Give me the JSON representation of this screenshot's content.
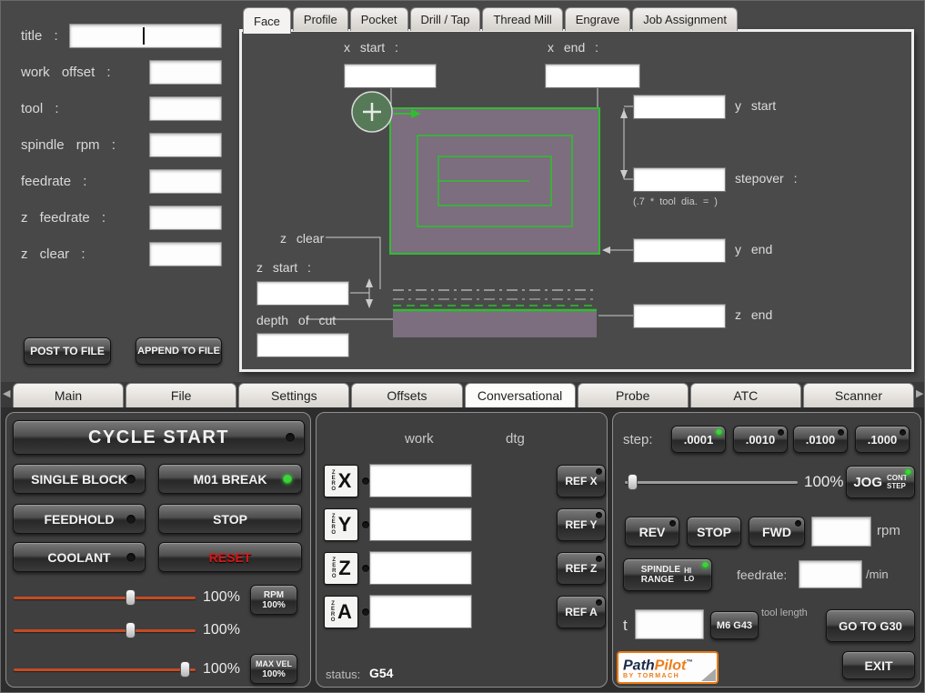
{
  "left_form": {
    "fields": [
      {
        "label": "title :",
        "value": ""
      },
      {
        "label": "work offset :",
        "value": ""
      },
      {
        "label": "tool :",
        "value": ""
      },
      {
        "label": "spindle rpm :",
        "value": ""
      },
      {
        "label": "feedrate :",
        "value": ""
      },
      {
        "label": "z feedrate :",
        "value": ""
      },
      {
        "label": "z clear :",
        "value": ""
      }
    ],
    "post_to_file": "POST TO FILE",
    "append_to_file": "APPEND TO FILE"
  },
  "conversational": {
    "tabs": [
      {
        "label": "Face",
        "selected": true
      },
      {
        "label": "Profile",
        "selected": false
      },
      {
        "label": "Pocket",
        "selected": false
      },
      {
        "label": "Drill / Tap",
        "selected": false
      },
      {
        "label": "Thread Mill",
        "selected": false
      },
      {
        "label": "Engrave",
        "selected": false
      },
      {
        "label": "Job Assignment",
        "selected": false
      }
    ],
    "face": {
      "x_start_label": "x start :",
      "x_end_label": "x end :",
      "y_start_label": "y start",
      "stepover_label": "stepover :",
      "stepover_hint": "(.7 * tool dia. = )",
      "y_end_label": "y end",
      "z_end_label": "z end",
      "z_clear_label": "z clear",
      "z_start_label": "z start :",
      "depth_of_cut_label": "depth of cut",
      "values": {
        "x_start": "",
        "x_end": "",
        "y_start": "",
        "stepover": "",
        "y_end": "",
        "z_end": "",
        "z_start": "",
        "depth_of_cut": ""
      }
    }
  },
  "screen_tabs": {
    "scroll_left_icon": "◀",
    "scroll_right_icon": "▶",
    "items": [
      {
        "label": "Main",
        "selected": false
      },
      {
        "label": "File",
        "selected": false
      },
      {
        "label": "Settings",
        "selected": false
      },
      {
        "label": "Offsets",
        "selected": false
      },
      {
        "label": "Conversational",
        "selected": true
      },
      {
        "label": "Probe",
        "selected": false
      },
      {
        "label": "ATC",
        "selected": false
      },
      {
        "label": "Scanner",
        "selected": false
      }
    ]
  },
  "control": {
    "cycle_start": "CYCLE START",
    "single_block": "SINGLE BLOCK",
    "m01_break": "M01 BREAK",
    "feedhold": "FEEDHOLD",
    "stop": "STOP",
    "coolant": "COOLANT",
    "reset": "RESET",
    "reset_color": "#d81616",
    "sliders": [
      {
        "name": "feedrate-override",
        "percent": "100%",
        "position": 64
      },
      {
        "name": "rpm-override",
        "percent": "100%",
        "position": 64
      },
      {
        "name": "maxvel-override",
        "percent": "100%",
        "position": 94
      }
    ],
    "rpm_btn": {
      "line1": "RPM",
      "line2": "100%"
    },
    "maxvel_btn": {
      "line1": "MAX VEL",
      "line2": "100%"
    }
  },
  "dro": {
    "work_header": "work",
    "dtg_header": "dtg",
    "zero_label": "ZERO",
    "axes": [
      {
        "letter": "X",
        "ref": "REF X",
        "value": ""
      },
      {
        "letter": "Y",
        "ref": "REF Y",
        "value": ""
      },
      {
        "letter": "Z",
        "ref": "REF Z",
        "value": ""
      },
      {
        "letter": "A",
        "ref": "REF A",
        "value": ""
      }
    ],
    "status_label": "status:",
    "status_value": "G54"
  },
  "jog": {
    "step_label": "step:",
    "step_buttons": [
      {
        "label": ".0001",
        "led": "green"
      },
      {
        "label": ".0010",
        "led": "off"
      },
      {
        "label": ".0100",
        "led": "off"
      },
      {
        "label": ".1000",
        "led": "off"
      }
    ],
    "jog_slider": {
      "percent": "100%",
      "position": 4
    },
    "jog_btn": {
      "main": "JOG",
      "top": "CONT",
      "bottom": "STEP"
    },
    "rev": "REV",
    "spindle_stop": "STOP",
    "fwd": "FWD",
    "rpm_label": "rpm",
    "rpm_value": "",
    "spindle_range": {
      "line1": "SPINDLE",
      "line2": "RANGE",
      "hi": "HI",
      "lo": "LO"
    },
    "feedrate_label": "feedrate:",
    "feedrate_value": "",
    "per_min": "/min",
    "t_label": "t",
    "t_value": "",
    "m6_g43": "M6 G43",
    "tool_length": "tool length",
    "go_to_g30": "GO TO G30",
    "exit": "EXIT"
  },
  "logo": {
    "path": "Path",
    "pilot": "Pilot",
    "tm": "™",
    "by": "BY TORMACH"
  }
}
